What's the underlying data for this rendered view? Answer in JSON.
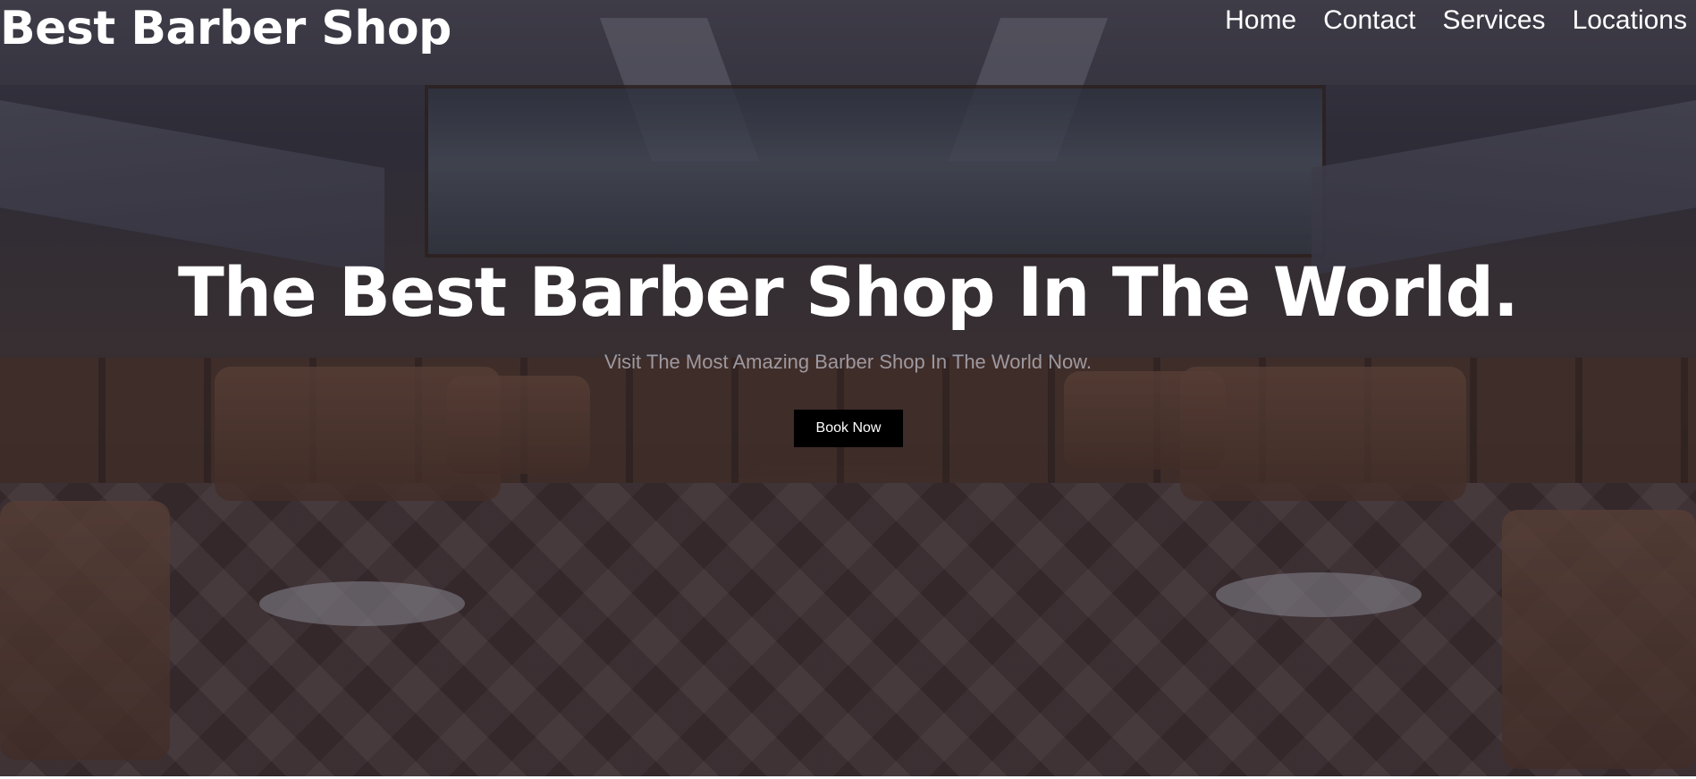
{
  "header": {
    "brand": "Best Barber Shop",
    "nav": [
      {
        "label": "Home"
      },
      {
        "label": "Contact"
      },
      {
        "label": "Services"
      },
      {
        "label": "Locations"
      }
    ]
  },
  "hero": {
    "headline": "The Best Barber Shop In The World.",
    "subheadline": "Visit The Most Amazing Barber Shop In The World Now.",
    "cta_label": "Book Now",
    "background_image": "barber-shop-interior"
  },
  "colors": {
    "text": "#ffffff",
    "button_bg": "#000000",
    "overlay": "#14121e"
  }
}
